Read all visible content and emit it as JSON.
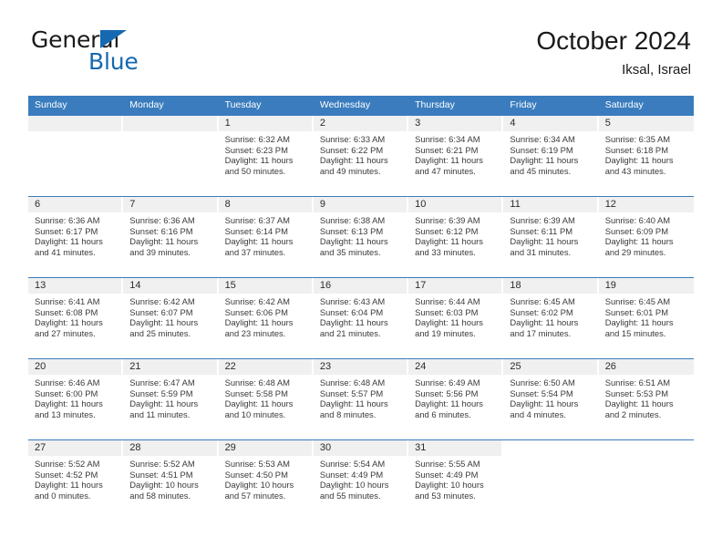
{
  "brand": {
    "name_top": "General",
    "name_bottom": "Blue",
    "triangle_color": "#1569b0"
  },
  "header": {
    "title": "October 2024",
    "subtitle": "Iksal, Israel"
  },
  "theme": {
    "header_blue": "#3a7cbe",
    "daynum_band": "#f0f0f0",
    "text": "#2b2b2b"
  },
  "weekdays": [
    "Sunday",
    "Monday",
    "Tuesday",
    "Wednesday",
    "Thursday",
    "Friday",
    "Saturday"
  ],
  "labels": {
    "sunrise_prefix": "Sunrise:",
    "sunset_prefix": "Sunset:",
    "daylight_prefix": "Daylight:"
  },
  "weeks": [
    [
      {
        "day": "",
        "sunrise": "",
        "sunset": "",
        "daylight1": "",
        "daylight2": "",
        "empty": true
      },
      {
        "day": "",
        "sunrise": "",
        "sunset": "",
        "daylight1": "",
        "daylight2": "",
        "empty": true
      },
      {
        "day": "1",
        "sunrise": "Sunrise: 6:32 AM",
        "sunset": "Sunset: 6:23 PM",
        "daylight1": "Daylight: 11 hours",
        "daylight2": "and 50 minutes."
      },
      {
        "day": "2",
        "sunrise": "Sunrise: 6:33 AM",
        "sunset": "Sunset: 6:22 PM",
        "daylight1": "Daylight: 11 hours",
        "daylight2": "and 49 minutes."
      },
      {
        "day": "3",
        "sunrise": "Sunrise: 6:34 AM",
        "sunset": "Sunset: 6:21 PM",
        "daylight1": "Daylight: 11 hours",
        "daylight2": "and 47 minutes."
      },
      {
        "day": "4",
        "sunrise": "Sunrise: 6:34 AM",
        "sunset": "Sunset: 6:19 PM",
        "daylight1": "Daylight: 11 hours",
        "daylight2": "and 45 minutes."
      },
      {
        "day": "5",
        "sunrise": "Sunrise: 6:35 AM",
        "sunset": "Sunset: 6:18 PM",
        "daylight1": "Daylight: 11 hours",
        "daylight2": "and 43 minutes."
      }
    ],
    [
      {
        "day": "6",
        "sunrise": "Sunrise: 6:36 AM",
        "sunset": "Sunset: 6:17 PM",
        "daylight1": "Daylight: 11 hours",
        "daylight2": "and 41 minutes."
      },
      {
        "day": "7",
        "sunrise": "Sunrise: 6:36 AM",
        "sunset": "Sunset: 6:16 PM",
        "daylight1": "Daylight: 11 hours",
        "daylight2": "and 39 minutes."
      },
      {
        "day": "8",
        "sunrise": "Sunrise: 6:37 AM",
        "sunset": "Sunset: 6:14 PM",
        "daylight1": "Daylight: 11 hours",
        "daylight2": "and 37 minutes."
      },
      {
        "day": "9",
        "sunrise": "Sunrise: 6:38 AM",
        "sunset": "Sunset: 6:13 PM",
        "daylight1": "Daylight: 11 hours",
        "daylight2": "and 35 minutes."
      },
      {
        "day": "10",
        "sunrise": "Sunrise: 6:39 AM",
        "sunset": "Sunset: 6:12 PM",
        "daylight1": "Daylight: 11 hours",
        "daylight2": "and 33 minutes."
      },
      {
        "day": "11",
        "sunrise": "Sunrise: 6:39 AM",
        "sunset": "Sunset: 6:11 PM",
        "daylight1": "Daylight: 11 hours",
        "daylight2": "and 31 minutes."
      },
      {
        "day": "12",
        "sunrise": "Sunrise: 6:40 AM",
        "sunset": "Sunset: 6:09 PM",
        "daylight1": "Daylight: 11 hours",
        "daylight2": "and 29 minutes."
      }
    ],
    [
      {
        "day": "13",
        "sunrise": "Sunrise: 6:41 AM",
        "sunset": "Sunset: 6:08 PM",
        "daylight1": "Daylight: 11 hours",
        "daylight2": "and 27 minutes."
      },
      {
        "day": "14",
        "sunrise": "Sunrise: 6:42 AM",
        "sunset": "Sunset: 6:07 PM",
        "daylight1": "Daylight: 11 hours",
        "daylight2": "and 25 minutes."
      },
      {
        "day": "15",
        "sunrise": "Sunrise: 6:42 AM",
        "sunset": "Sunset: 6:06 PM",
        "daylight1": "Daylight: 11 hours",
        "daylight2": "and 23 minutes."
      },
      {
        "day": "16",
        "sunrise": "Sunrise: 6:43 AM",
        "sunset": "Sunset: 6:04 PM",
        "daylight1": "Daylight: 11 hours",
        "daylight2": "and 21 minutes."
      },
      {
        "day": "17",
        "sunrise": "Sunrise: 6:44 AM",
        "sunset": "Sunset: 6:03 PM",
        "daylight1": "Daylight: 11 hours",
        "daylight2": "and 19 minutes."
      },
      {
        "day": "18",
        "sunrise": "Sunrise: 6:45 AM",
        "sunset": "Sunset: 6:02 PM",
        "daylight1": "Daylight: 11 hours",
        "daylight2": "and 17 minutes."
      },
      {
        "day": "19",
        "sunrise": "Sunrise: 6:45 AM",
        "sunset": "Sunset: 6:01 PM",
        "daylight1": "Daylight: 11 hours",
        "daylight2": "and 15 minutes."
      }
    ],
    [
      {
        "day": "20",
        "sunrise": "Sunrise: 6:46 AM",
        "sunset": "Sunset: 6:00 PM",
        "daylight1": "Daylight: 11 hours",
        "daylight2": "and 13 minutes."
      },
      {
        "day": "21",
        "sunrise": "Sunrise: 6:47 AM",
        "sunset": "Sunset: 5:59 PM",
        "daylight1": "Daylight: 11 hours",
        "daylight2": "and 11 minutes."
      },
      {
        "day": "22",
        "sunrise": "Sunrise: 6:48 AM",
        "sunset": "Sunset: 5:58 PM",
        "daylight1": "Daylight: 11 hours",
        "daylight2": "and 10 minutes."
      },
      {
        "day": "23",
        "sunrise": "Sunrise: 6:48 AM",
        "sunset": "Sunset: 5:57 PM",
        "daylight1": "Daylight: 11 hours",
        "daylight2": "and 8 minutes."
      },
      {
        "day": "24",
        "sunrise": "Sunrise: 6:49 AM",
        "sunset": "Sunset: 5:56 PM",
        "daylight1": "Daylight: 11 hours",
        "daylight2": "and 6 minutes."
      },
      {
        "day": "25",
        "sunrise": "Sunrise: 6:50 AM",
        "sunset": "Sunset: 5:54 PM",
        "daylight1": "Daylight: 11 hours",
        "daylight2": "and 4 minutes."
      },
      {
        "day": "26",
        "sunrise": "Sunrise: 6:51 AM",
        "sunset": "Sunset: 5:53 PM",
        "daylight1": "Daylight: 11 hours",
        "daylight2": "and 2 minutes."
      }
    ],
    [
      {
        "day": "27",
        "sunrise": "Sunrise: 5:52 AM",
        "sunset": "Sunset: 4:52 PM",
        "daylight1": "Daylight: 11 hours",
        "daylight2": "and 0 minutes."
      },
      {
        "day": "28",
        "sunrise": "Sunrise: 5:52 AM",
        "sunset": "Sunset: 4:51 PM",
        "daylight1": "Daylight: 10 hours",
        "daylight2": "and 58 minutes."
      },
      {
        "day": "29",
        "sunrise": "Sunrise: 5:53 AM",
        "sunset": "Sunset: 4:50 PM",
        "daylight1": "Daylight: 10 hours",
        "daylight2": "and 57 minutes."
      },
      {
        "day": "30",
        "sunrise": "Sunrise: 5:54 AM",
        "sunset": "Sunset: 4:49 PM",
        "daylight1": "Daylight: 10 hours",
        "daylight2": "and 55 minutes."
      },
      {
        "day": "31",
        "sunrise": "Sunrise: 5:55 AM",
        "sunset": "Sunset: 4:49 PM",
        "daylight1": "Daylight: 10 hours",
        "daylight2": "and 53 minutes."
      },
      {
        "day": "",
        "sunrise": "",
        "sunset": "",
        "daylight1": "",
        "daylight2": "",
        "blank": true
      },
      {
        "day": "",
        "sunrise": "",
        "sunset": "",
        "daylight1": "",
        "daylight2": "",
        "blank": true
      }
    ]
  ]
}
